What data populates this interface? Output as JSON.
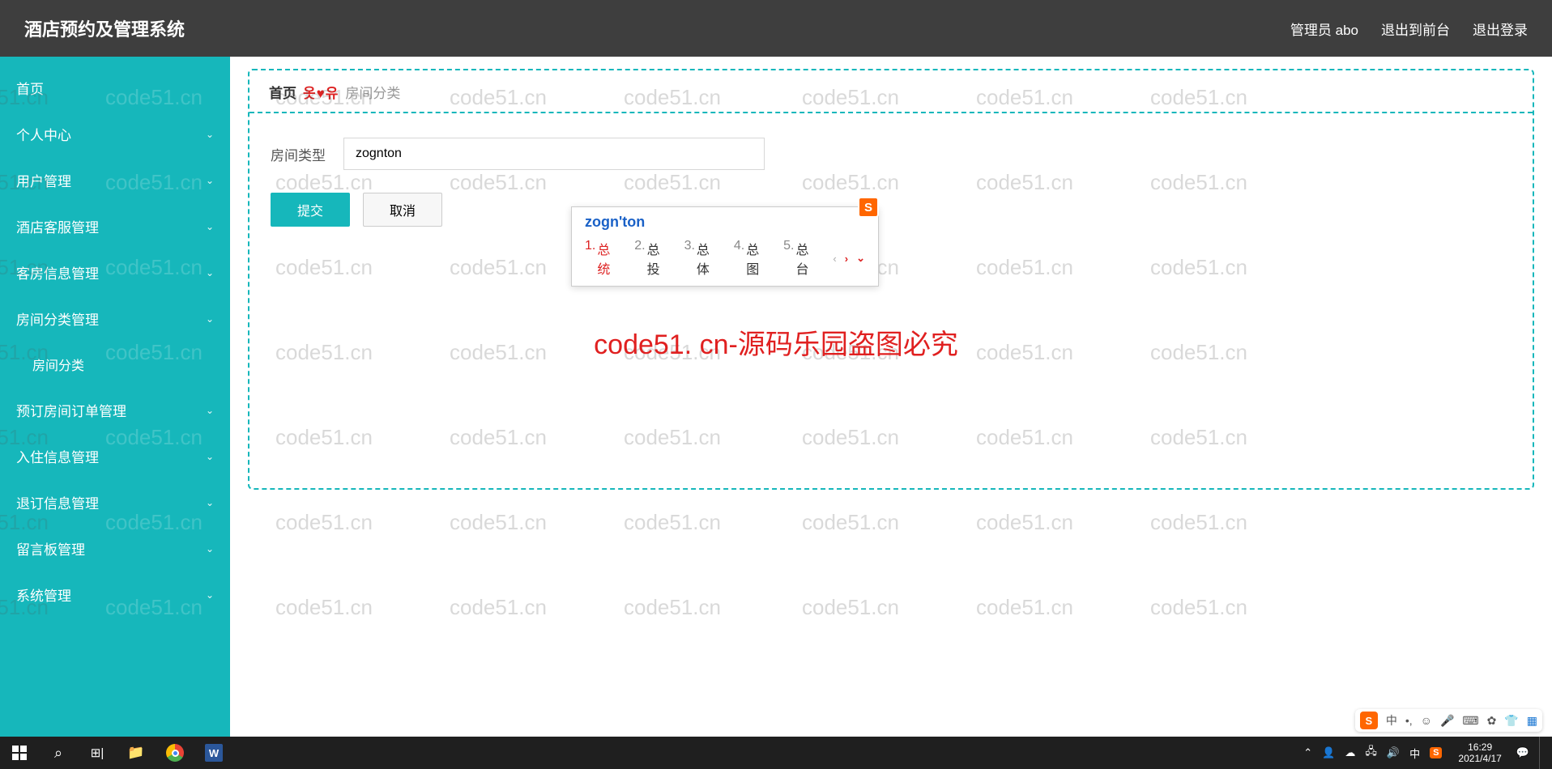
{
  "header": {
    "title": "酒店预约及管理系统",
    "user": "管理员 abo",
    "front": "退出到前台",
    "logout": "退出登录"
  },
  "sidebar": {
    "items": [
      {
        "label": "首页",
        "expandable": false
      },
      {
        "label": "个人中心",
        "expandable": true
      },
      {
        "label": "用户管理",
        "expandable": true
      },
      {
        "label": "酒店客服管理",
        "expandable": true
      },
      {
        "label": "客房信息管理",
        "expandable": true
      },
      {
        "label": "房间分类管理",
        "expandable": true
      },
      {
        "label": "预订房间订单管理",
        "expandable": true
      },
      {
        "label": "入住信息管理",
        "expandable": true
      },
      {
        "label": "退订信息管理",
        "expandable": true
      },
      {
        "label": "留言板管理",
        "expandable": true
      },
      {
        "label": "系统管理",
        "expandable": true
      }
    ],
    "sub_after_index": 5,
    "sub_label": "房间分类"
  },
  "breadcrumb": {
    "home": "首页",
    "icons": "옷♥유",
    "current": "房间分类"
  },
  "form": {
    "label": "房间类型",
    "value": "zognton",
    "submit": "提交",
    "cancel": "取消"
  },
  "ime": {
    "logo": "S",
    "composition": "zogn'ton",
    "candidates": [
      {
        "n": "1.",
        "w": "总统"
      },
      {
        "n": "2.",
        "w": "总投"
      },
      {
        "n": "3.",
        "w": "总体"
      },
      {
        "n": "4.",
        "w": "总图"
      },
      {
        "n": "5.",
        "w": "总台"
      }
    ]
  },
  "ime_bar": {
    "logo": "S",
    "lang": "中"
  },
  "watermark": {
    "text": "code51.cn",
    "big": "code51. cn-源码乐园盗图必究"
  },
  "taskbar": {
    "lang": "中",
    "time": "16:29",
    "date": "2021/4/17"
  }
}
